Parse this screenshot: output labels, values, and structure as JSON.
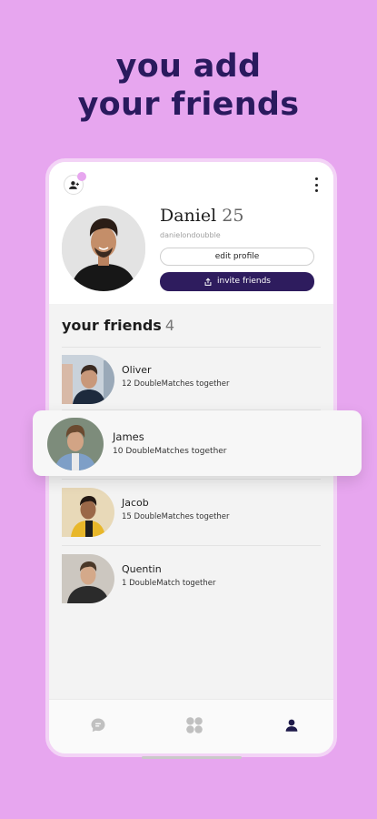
{
  "headline": {
    "line1": "you add",
    "line2": "your friends"
  },
  "profile": {
    "name": "Daniel",
    "age": "25",
    "username": "danielondoubble",
    "edit_label": "edit profile",
    "invite_label": "invite friends"
  },
  "friends": {
    "title": "your friends",
    "count": "4",
    "items": [
      {
        "name": "Oliver",
        "meta": "12 DoubleMatches together"
      },
      {
        "name": "James",
        "meta": "10 DoubleMatches together"
      },
      {
        "name": "Jacob",
        "meta": "15 DoubleMatches together"
      },
      {
        "name": "Quentin",
        "meta": "1 DoubleMatch together"
      }
    ]
  },
  "icons": {
    "add_friend": "person-plus-icon",
    "more": "kebab-menu-icon",
    "invite": "share-icon",
    "nav_chat": "chat-bubble-icon",
    "nav_matches": "grid-clover-icon",
    "nav_profile": "person-icon"
  },
  "colors": {
    "background": "#e7a6ef",
    "headline": "#2a1a5e",
    "primary_button": "#2e1c5e",
    "nav_active": "#1e1a4a",
    "nav_inactive": "#c0c0c0"
  }
}
